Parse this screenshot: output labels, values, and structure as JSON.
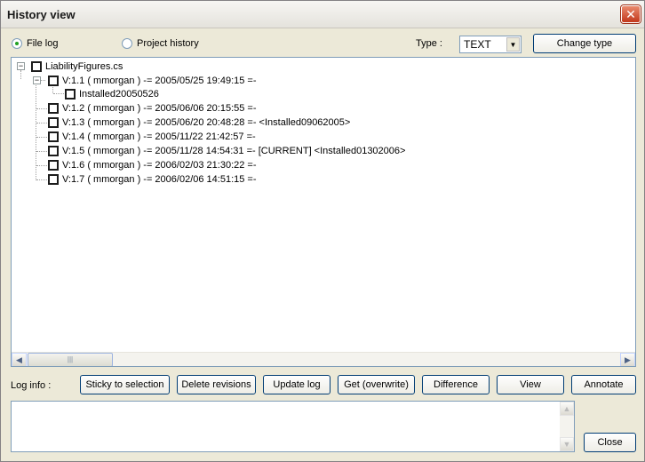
{
  "window": {
    "title": "History view",
    "close_glyph": "✕"
  },
  "mode": {
    "options": [
      {
        "label": "File log",
        "checked": true
      },
      {
        "label": "Project history",
        "checked": false
      }
    ]
  },
  "type_filter": {
    "label": "Type :",
    "value": "TEXT"
  },
  "buttons": {
    "change_type": "Change type",
    "sticky": "Sticky to selection",
    "delete": "Delete revisions",
    "update": "Update log",
    "get": "Get (overwrite)",
    "difference": "Difference",
    "view": "View",
    "annotate": "Annotate",
    "close": "Close"
  },
  "tree": {
    "root": "LiabilityFigures.cs",
    "revisions": [
      {
        "text": "V:1.1 ( mmorgan ) -= 2005/05/25 19:49:15 =-",
        "children": [
          "Installed20050526"
        ]
      },
      {
        "text": "V:1.2 ( mmorgan ) -= 2005/06/06 20:15:55 =-"
      },
      {
        "text": "V:1.3 ( mmorgan ) -= 2005/06/20 20:48:28 =- <Installed09062005>"
      },
      {
        "text": "V:1.4 ( mmorgan ) -= 2005/11/22 21:42:57 =-"
      },
      {
        "text": "V:1.5 ( mmorgan ) -= 2005/11/28 14:54:31 =- [CURRENT] <Installed01302006>"
      },
      {
        "text": "V:1.6 ( mmorgan ) -= 2006/02/03 21:30:22 =-"
      },
      {
        "text": "V:1.7 ( mmorgan ) -= 2006/02/06 14:51:15 =-"
      }
    ]
  },
  "log_info": {
    "label": "Log info :",
    "value": ""
  },
  "icons": {
    "expander": "minus-box-icon",
    "checkbox": "checkbox-unchecked-icon"
  }
}
